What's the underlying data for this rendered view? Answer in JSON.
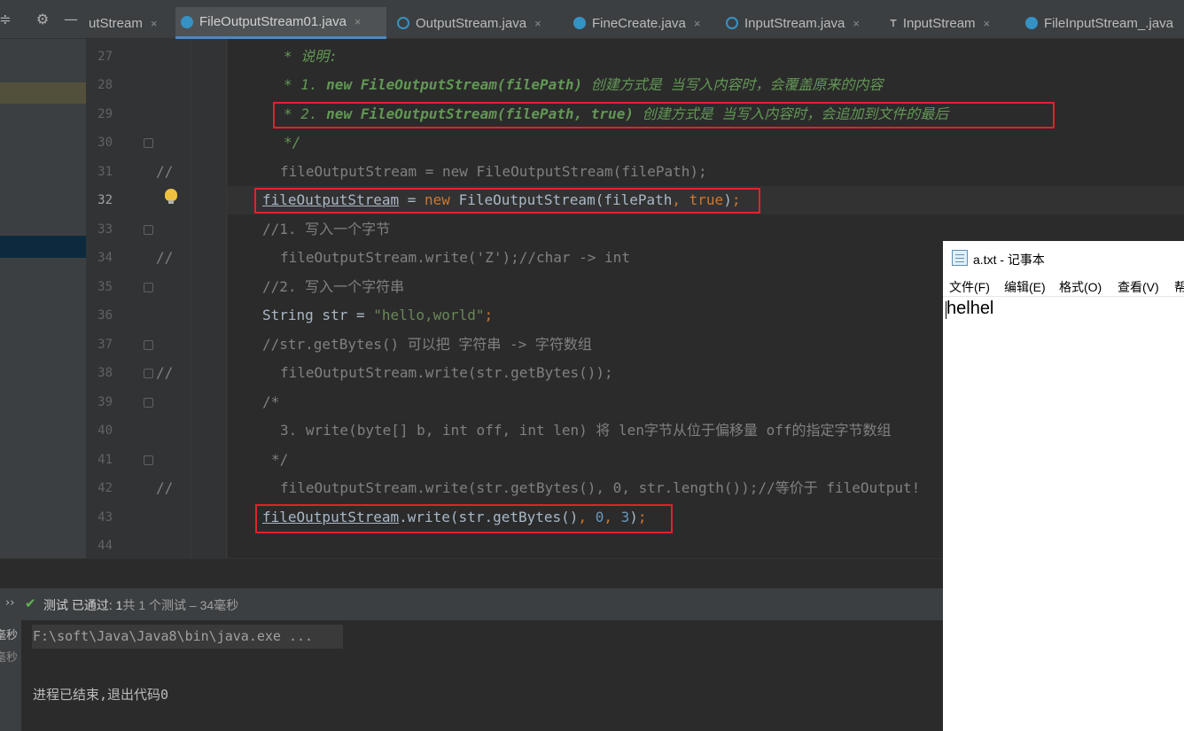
{
  "tabs": [
    {
      "label": "utStream",
      "close": "×"
    },
    {
      "label": "FileOutputStream01.java",
      "close": "×"
    },
    {
      "label": "OutputStream.java",
      "close": "×"
    },
    {
      "label": "FineCreate.java",
      "close": "×"
    },
    {
      "label": "InputStream.java",
      "close": "×"
    },
    {
      "label": "InputStream",
      "close": "×"
    },
    {
      "label": "FileInputStream_.java",
      "close": ""
    }
  ],
  "gutter_comments": [
    "//",
    "//",
    "//",
    "//"
  ],
  "line_numbers": [
    "27",
    "28",
    "29",
    "30",
    "31",
    "32",
    "33",
    "34",
    "35",
    "36",
    "37",
    "38",
    "39",
    "40",
    "41",
    "42",
    "43",
    "44"
  ],
  "code": {
    "l27": "* 说明:",
    "l28a": "* 1. ",
    "l28b": "new FileOutputStream(filePath)",
    "l28c": " 创建方式是 当写入内容时，会覆盖原来的内容",
    "l29a": "* 2. ",
    "l29b": "new FileOutputStream(filePath, true)",
    "l29c": " 创建方式是 当写入内容时，会追加到文件的最后",
    "l30": "*/",
    "l31": "fileOutputStream = new FileOutputStream(filePath);",
    "l32_field": "fileOutputStream",
    "l32_eq": " = ",
    "l32_new": "new",
    "l32_ctor": " FileOutputStream(filePath",
    "l32_comma": ", ",
    "l32_true": "true",
    "l32_end": ")",
    "l32_semi": ";",
    "l33": "//1. 写入一个字节",
    "l34": "fileOutputStream.write('Z');//char -> int",
    "l35": "//2. 写入一个字符串",
    "l36_type": "String str = ",
    "l36_str": "\"hello,world\"",
    "l36_semi": ";",
    "l37": "//str.getBytes() 可以把 字符串 -> 字符数组",
    "l38": "fileOutputStream.write(str.getBytes());",
    "l39": "/*",
    "l40": "3. write(byte[] b, int off, int len) 将 len字节从位于偏移量 off的指定字节数组",
    "l41": "*/",
    "l42": "fileOutputStream.write(str.getBytes(), 0, str.length());//等价于 fileOutput!",
    "l43_field": "fileOutputStream",
    "l43_call": ".write(str.getBytes()",
    "l43_c1": ", ",
    "l43_zero": "0",
    "l43_c2": ", ",
    "l43_three": "3",
    "l43_end": ")",
    "l43_semi": ";"
  },
  "run": {
    "status_prefix": "››",
    "status_check": "✔",
    "status_label": "测试 已通过:",
    "status_count": " 1",
    "status_detail": "共 1 个测试 – 34毫秒",
    "side1": "毫秒",
    "side2": "毫秒",
    "cmd": "F:\\soft\\Java\\Java8\\bin\\java.exe ...",
    "exit": "进程已结束,退出代码0"
  },
  "notepad": {
    "title": "a.txt - 记事本",
    "menu": [
      "文件(F)",
      "编辑(E)",
      "格式(O)",
      "查看(V)",
      "帮"
    ],
    "content": "helhel"
  }
}
